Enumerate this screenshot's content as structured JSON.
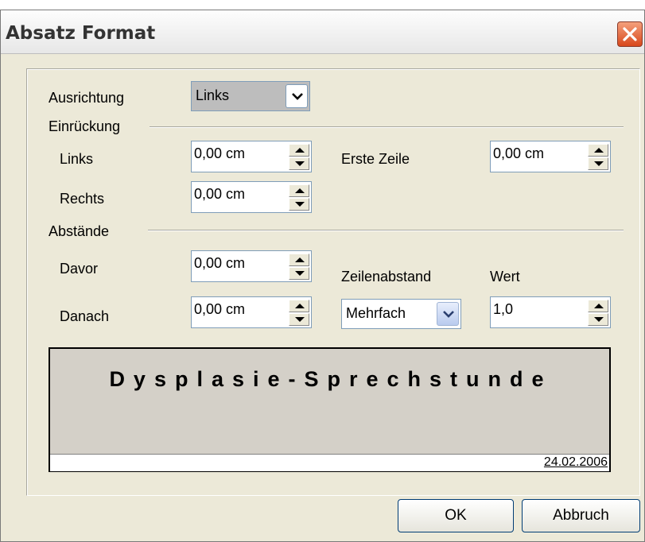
{
  "window": {
    "title": "Absatz Format"
  },
  "alignment": {
    "label": "Ausrichtung",
    "value": "Links"
  },
  "indent": {
    "section_label": "Einrückung",
    "left_label": "Links",
    "left_value": "0,00 cm",
    "right_label": "Rechts",
    "right_value": "0,00 cm",
    "first_line_label": "Erste Zeile",
    "first_line_value": "0,00 cm"
  },
  "spacing": {
    "section_label": "Abstände",
    "before_label": "Davor",
    "before_value": "0,00 cm",
    "after_label": "Danach",
    "after_value": "0,00 cm",
    "line_spacing_label": "Zeilenabstand",
    "line_spacing_value": "Mehrfach",
    "amount_label": "Wert",
    "amount_value": "1,0"
  },
  "preview": {
    "text": "Dysplasie-Sprechstunde",
    "date": "24.02.2006"
  },
  "buttons": {
    "ok": "OK",
    "cancel": "Abbruch"
  },
  "icons": {
    "close": "close-icon",
    "dropdown": "chevron-down-icon",
    "spin_up": "arrow-up-icon",
    "spin_down": "arrow-down-icon"
  },
  "colors": {
    "dialog_bg": "#ece9d8",
    "close_button": "#d8481c",
    "preview_bg": "#d4d0c8",
    "field_border": "#7f9db9"
  }
}
